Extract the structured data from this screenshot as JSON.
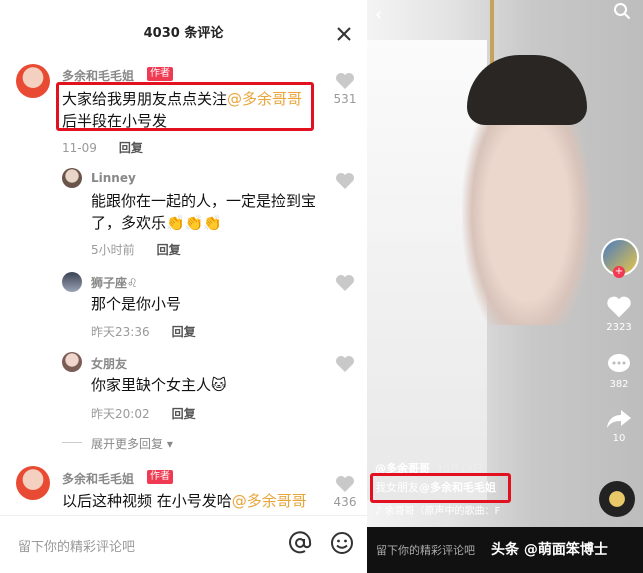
{
  "left": {
    "header_title": "4030 条评论",
    "comments": [
      {
        "user": "多余和毛毛姐",
        "badge": "作者",
        "text_plain": "大家给我男朋友点点关注",
        "mention": "@多余哥哥",
        "text_line2": "后半段在小号发",
        "date": "11-09",
        "reply": "回复",
        "likes": "531"
      },
      {
        "user": "Linney",
        "text_line1": "能跟你在一起的人，一定是捡到宝",
        "text_line2": "了，多欢乐👏👏👏",
        "date": "5小时前",
        "reply": "回复"
      },
      {
        "user": "狮子座♌",
        "text_line1": "那个是你小号",
        "date": "昨天23:36",
        "reply": "回复"
      },
      {
        "user": "女朋友",
        "text_line1": "你家里缺个女主人🐱",
        "date": "昨天20:02",
        "reply": "回复"
      },
      {
        "user": "多余和毛毛姐",
        "badge": "作者",
        "text_plain": "以后这种视频 在小号发哈",
        "mention": "@多余哥哥",
        "likes": "436"
      }
    ],
    "expand_more": "展开更多回复 ▾",
    "input_placeholder": "留下你的精彩评论吧",
    "icons": [
      "close-icon",
      "heart-icon",
      "at-icon",
      "emoji-icon"
    ]
  },
  "right": {
    "likes": "2323",
    "comments": "382",
    "shares": "10",
    "author": "@多余哥哥",
    "date": "10月19日",
    "desc_plain": "我女朋友",
    "desc_mention": "@多余和毛毛姐",
    "music": "♪ 余哥哥（原声中的歌曲：F",
    "input_placeholder": "留下你的精彩评论吧",
    "watermark": "头条 @萌面笨博士"
  }
}
